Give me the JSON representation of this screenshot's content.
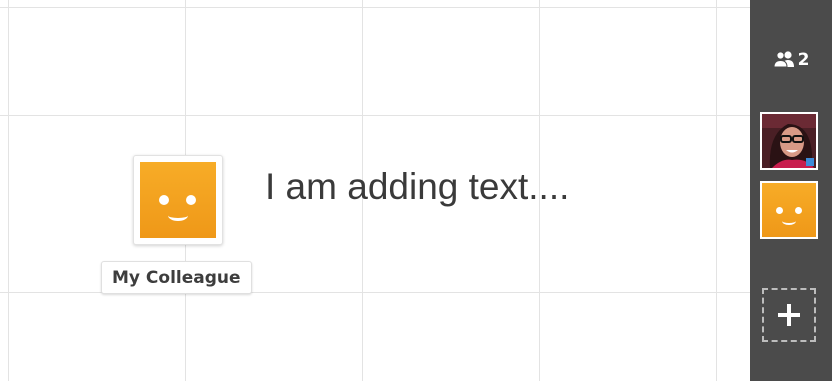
{
  "board": {
    "text": "I am adding text....",
    "collaborator": {
      "name": "My Colleague",
      "avatar_icon": "smiley-face-icon",
      "avatar_color": "#f5a623"
    }
  },
  "sidebar": {
    "participants": {
      "icon": "people-icon",
      "count": "2"
    },
    "members": [
      {
        "type": "photo",
        "icon": "user-photo-avatar"
      },
      {
        "type": "smiley",
        "icon": "smiley-face-icon",
        "color": "#f5a623"
      }
    ],
    "add_button": {
      "icon": "plus-icon"
    }
  },
  "colors": {
    "sidebar_bg": "#4b4b4b",
    "grid_line": "#e3e3e3",
    "accent": "#f5a623"
  }
}
